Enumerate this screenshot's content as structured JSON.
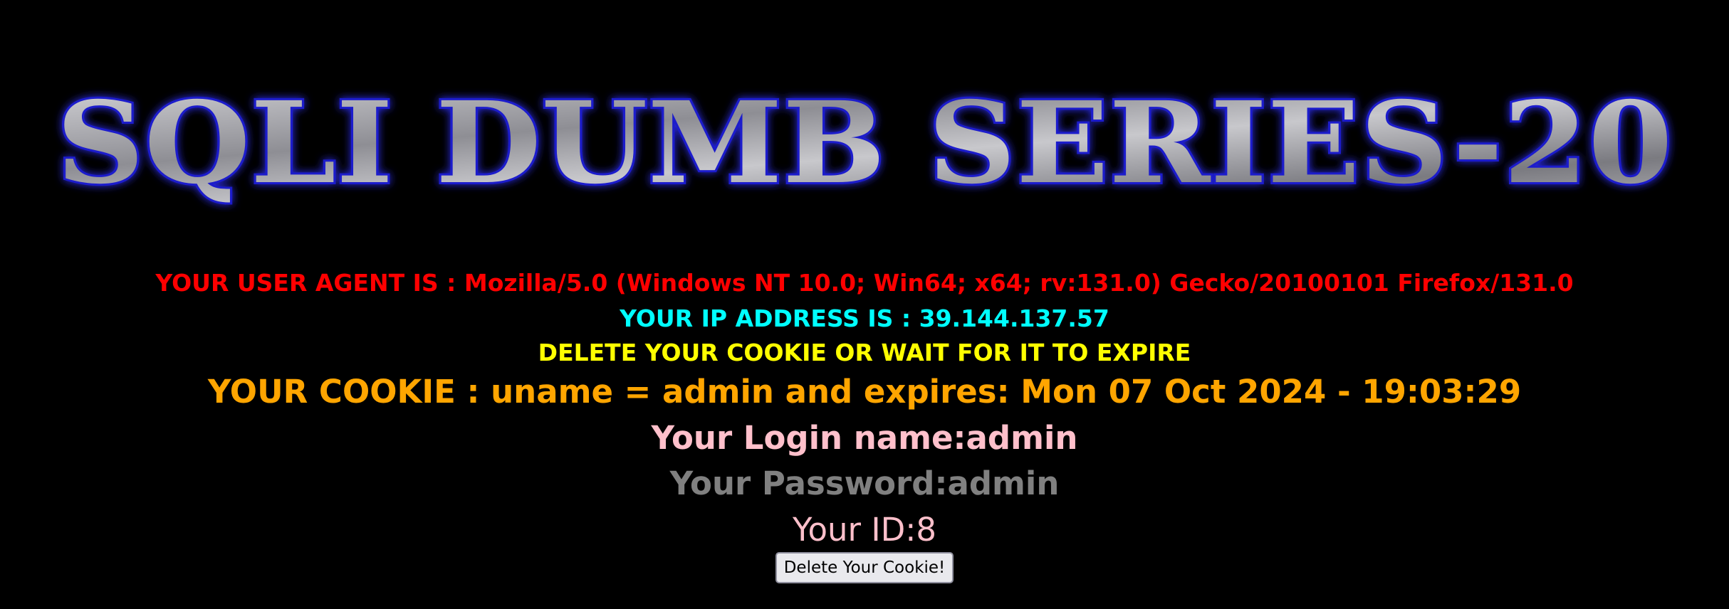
{
  "banner": {
    "title": "SQLI DUMB SERIES-20",
    "colors": {
      "fill": "#b0b0b4",
      "stroke": "#1a1acc",
      "glow": "#3030ff"
    }
  },
  "info": {
    "user_agent": "YOUR USER AGENT IS : Mozilla/5.0 (Windows NT 10.0; Win64; x64; rv:131.0) Gecko/20100101 Firefox/131.0",
    "ip_address": "YOUR IP ADDRESS IS : 39.144.137.57",
    "delete_notice": "DELETE YOUR COOKIE OR WAIT FOR IT TO EXPIRE",
    "cookie": "YOUR COOKIE : uname = admin and expires: Mon 07 Oct 2024 - 19:03:29",
    "login_name": "Your Login name:admin",
    "password": "Your Password:admin",
    "user_id": "Your ID:8"
  },
  "actions": {
    "delete_cookie_label": "Delete Your Cookie!"
  },
  "colors": {
    "background": "#000000",
    "user_agent": "#ff0000",
    "ip_address": "#00ffff",
    "delete_notice": "#ffff00",
    "cookie": "#ffa500",
    "login_name": "#ffc0cb",
    "password": "#808080",
    "user_id": "#ffc0cb"
  }
}
